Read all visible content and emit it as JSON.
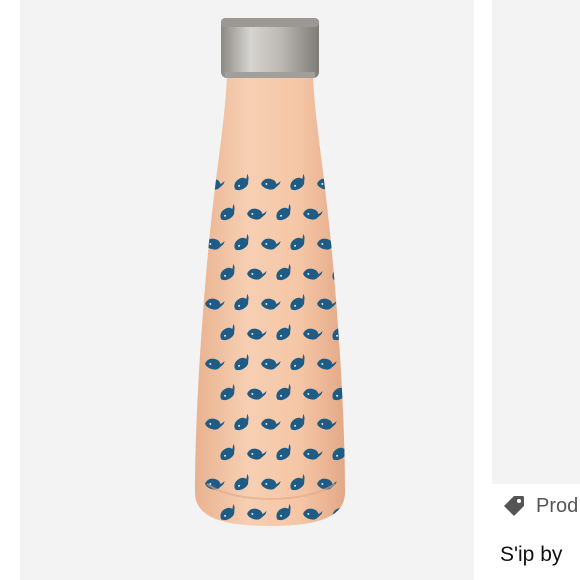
{
  "listing": {
    "tag_label": "Prod",
    "product_title": "S'ip by",
    "tag_icon": "price-tag-icon"
  },
  "product_image": {
    "subject": "water-bottle",
    "pattern": "whale-pattern",
    "colors": {
      "bottle_body": "#f4c3a1",
      "cap": "#b3b0ab",
      "whales": "#1e5c86"
    }
  }
}
